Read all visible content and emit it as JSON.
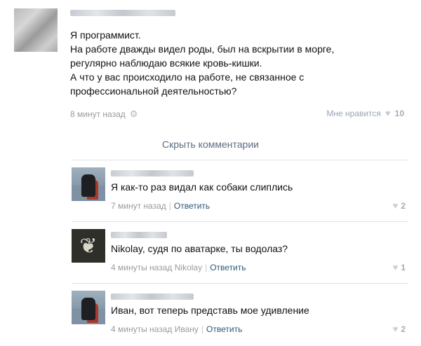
{
  "post": {
    "lines": [
      "Я программист.",
      "На работе дважды видел роды, был на вскрытии в морге,",
      "регулярно наблюдаю всякие кровь-кишки.",
      "А что у вас происходило на работе, не связанное с",
      "профессиональной деятельностью?"
    ],
    "time": "8 минут назад",
    "like_label": "Мне нравится",
    "likes": "10"
  },
  "hide_comments": "Скрыть комментарии",
  "comments": [
    {
      "avatar": "diver-photo",
      "text": "Я как-то раз видал как собаки слиплись",
      "time": "7 минут назад",
      "reply_to": "",
      "reply_label": "Ответить",
      "likes": "2"
    },
    {
      "avatar": "ornament-image",
      "text": "Nikolay, судя по аватарке, ты водолаз?",
      "time": "4 минуты назад",
      "reply_to": "Nikolay",
      "reply_label": "Ответить",
      "likes": "1"
    },
    {
      "avatar": "diver-photo",
      "text": "Иван, вот теперь представь мое удивление",
      "time": "4 минуты назад",
      "reply_to": "Ивану",
      "reply_label": "Ответить",
      "likes": "2"
    }
  ],
  "icons": {
    "gear": "⚙",
    "heart": "♥"
  }
}
